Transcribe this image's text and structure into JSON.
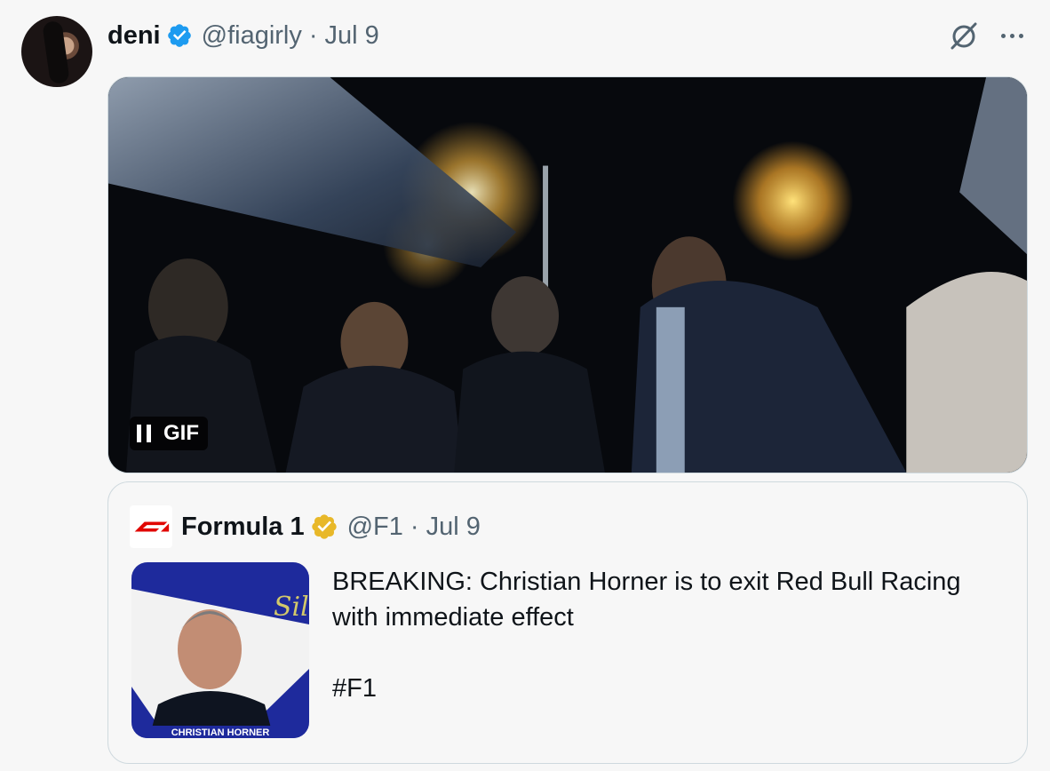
{
  "tweet": {
    "author_name": "deni",
    "handle": "@fiagirly",
    "separator": "·",
    "date": "Jul 9",
    "media": {
      "badge_label": "GIF",
      "pause_icon": "pause-icon"
    }
  },
  "quoted": {
    "author_name": "Formula 1",
    "handle": "@F1",
    "separator": "·",
    "date": "Jul 9",
    "text_line1": "BREAKING: Christian Horner is to exit Red Bull Racing",
    "text_line2": "with immediate effect",
    "hashtag": "#F1",
    "thumbnail_caption": "CHRISTIAN HORNER",
    "thumbnail_script": "Silver"
  },
  "colors": {
    "verified_blue": "#1d9bf0",
    "verified_gold": "#e8b829",
    "f1_red": "#e10600",
    "secondary_text": "#536471"
  },
  "icons": {
    "grok": "grok-icon",
    "more": "more-icon",
    "verified": "verified-badge-icon",
    "gold_verified": "gold-verified-badge-icon",
    "f1_logo": "f1-logo-icon"
  }
}
